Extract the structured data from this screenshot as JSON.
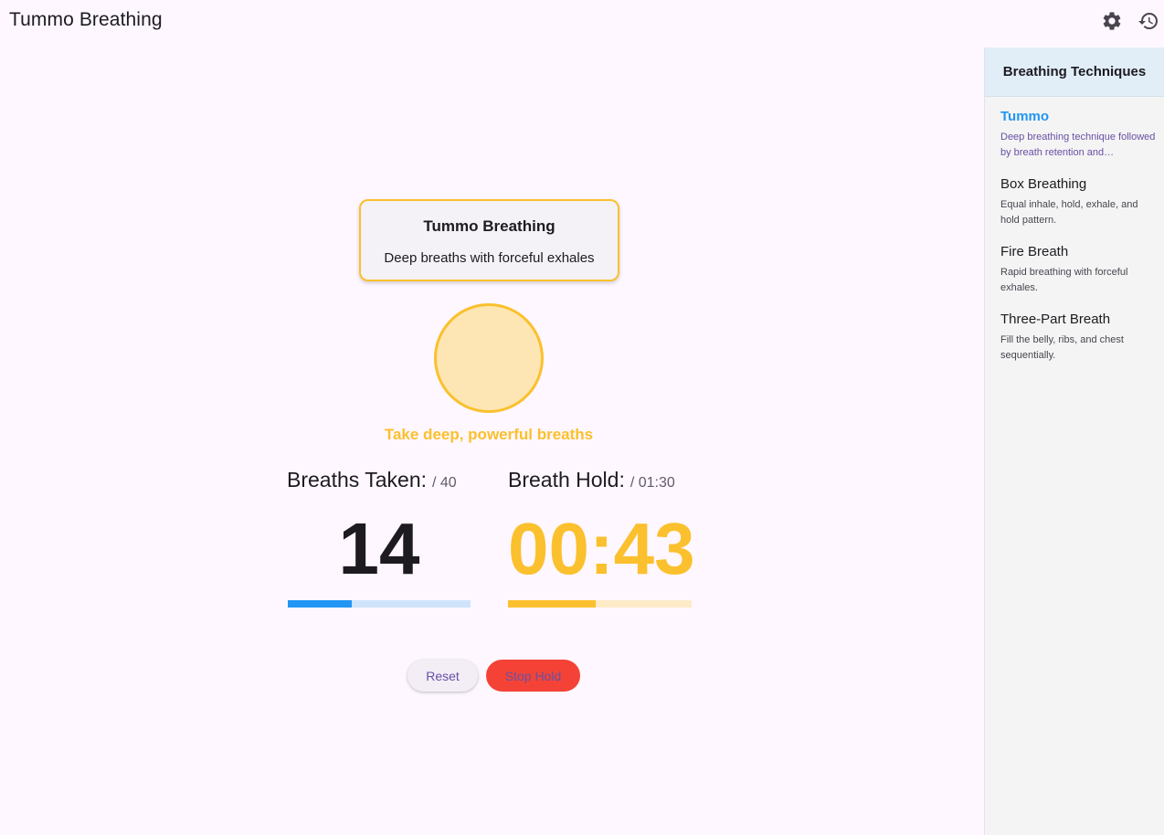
{
  "app_title": "Tummo Breathing",
  "appbar": {
    "settings_icon": "settings-icon",
    "history_icon": "history-icon"
  },
  "technique_card": {
    "title": "Tummo Breathing",
    "description": "Deep breaths with forceful exhales"
  },
  "instruction": "Take deep, powerful breaths",
  "breaths": {
    "label": "Breaths Taken:",
    "target": "/ 40",
    "value": "14",
    "progress_fraction": 0.35
  },
  "hold": {
    "label": "Breath Hold:",
    "target": "/ 01:30",
    "value": "00:43",
    "progress_fraction": 0.4778
  },
  "buttons": {
    "reset": "Reset",
    "stop_hold": "Stop Hold"
  },
  "sidebar": {
    "header": "Breathing Techniques",
    "items": [
      {
        "name": "Tummo",
        "description": "Deep breathing technique followed by breath retention and visualization.",
        "active": true
      },
      {
        "name": "Box Breathing",
        "description": "Equal inhale, hold, exhale, and hold pattern.",
        "active": false
      },
      {
        "name": "Fire Breath",
        "description": "Rapid breathing with forceful exhales.",
        "active": false
      },
      {
        "name": "Three-Part Breath",
        "description": "Fill the belly, ribs, and chest sequentially.",
        "active": false
      }
    ]
  },
  "colors": {
    "accent_amber": "#fbc02d",
    "accent_blue": "#2196f3",
    "stop_red": "#f44336",
    "primary_purple": "#6750a4"
  }
}
